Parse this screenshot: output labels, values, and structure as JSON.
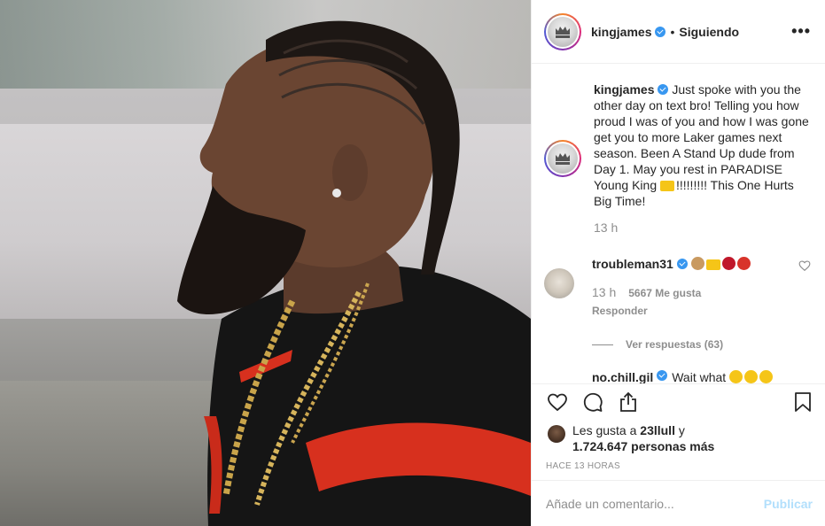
{
  "header": {
    "username": "kingjames",
    "separator": "•",
    "follow_status": "Siguiendo",
    "more": "•••"
  },
  "caption": {
    "username": "kingjames",
    "text_1": "Just spoke with you the other day on text bro! Telling you how proud I was of you and how I was gone get you to more Laker games next season. Been A Stand Up dude from Day 1. May you rest in PARADISE Young King",
    "text_2": "!!!!!!!!! This One Hurts Big Time!",
    "time": "13 h"
  },
  "comments": [
    {
      "username": "troubleman31",
      "time": "13 h",
      "likes": "5667 Me gusta",
      "reply": "Responder"
    }
  ],
  "view_replies": "Ver respuestas (63)",
  "comment2": {
    "username": "no.chill.gil",
    "text": "Wait what"
  },
  "likes": {
    "prefix": "Les gusta a",
    "user": "23llull",
    "conj": "y",
    "count": "1.724.647 personas más"
  },
  "posted_ago": "Hace 13 horas",
  "add_comment": {
    "placeholder": "Añade un comentario...",
    "publish": "Publicar"
  },
  "icons": [
    "heart-icon",
    "comment-icon",
    "share-icon",
    "bookmark-icon",
    "verified-icon"
  ],
  "colors": {
    "verified": "#3897f0",
    "publish_disabled": "#b2dffc",
    "muted_text": "#8e8e8e"
  }
}
